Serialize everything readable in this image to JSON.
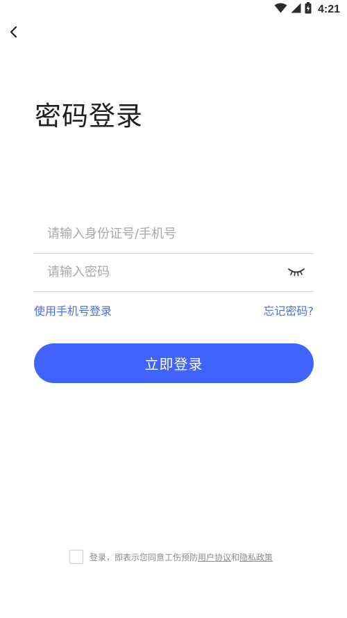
{
  "status_bar": {
    "time": "4:21",
    "icons": [
      "wifi-icon",
      "signal-icon",
      "battery-charging-icon"
    ]
  },
  "header": {
    "back_icon": "chevron-left-icon",
    "title": "密码登录"
  },
  "form": {
    "id_placeholder": "请输入身份证号/手机号",
    "id_value": "",
    "password_placeholder": "请输入密码",
    "password_value": "",
    "eye_icon": "eye-closed-icon"
  },
  "links": {
    "phone_login": "使用手机号登录",
    "forgot_password": "忘记密码?"
  },
  "login_button": {
    "label": "立即登录"
  },
  "agreement": {
    "checked": false,
    "prefix": "登录，即表示您同意工伤预防",
    "user_agreement": "用户协议",
    "and": "和",
    "privacy_policy": "隐私政策"
  },
  "colors": {
    "primary": "#4063fb",
    "link": "#4a6fe0",
    "placeholder": "#a8a8a8",
    "divider": "#d6d6d6"
  }
}
